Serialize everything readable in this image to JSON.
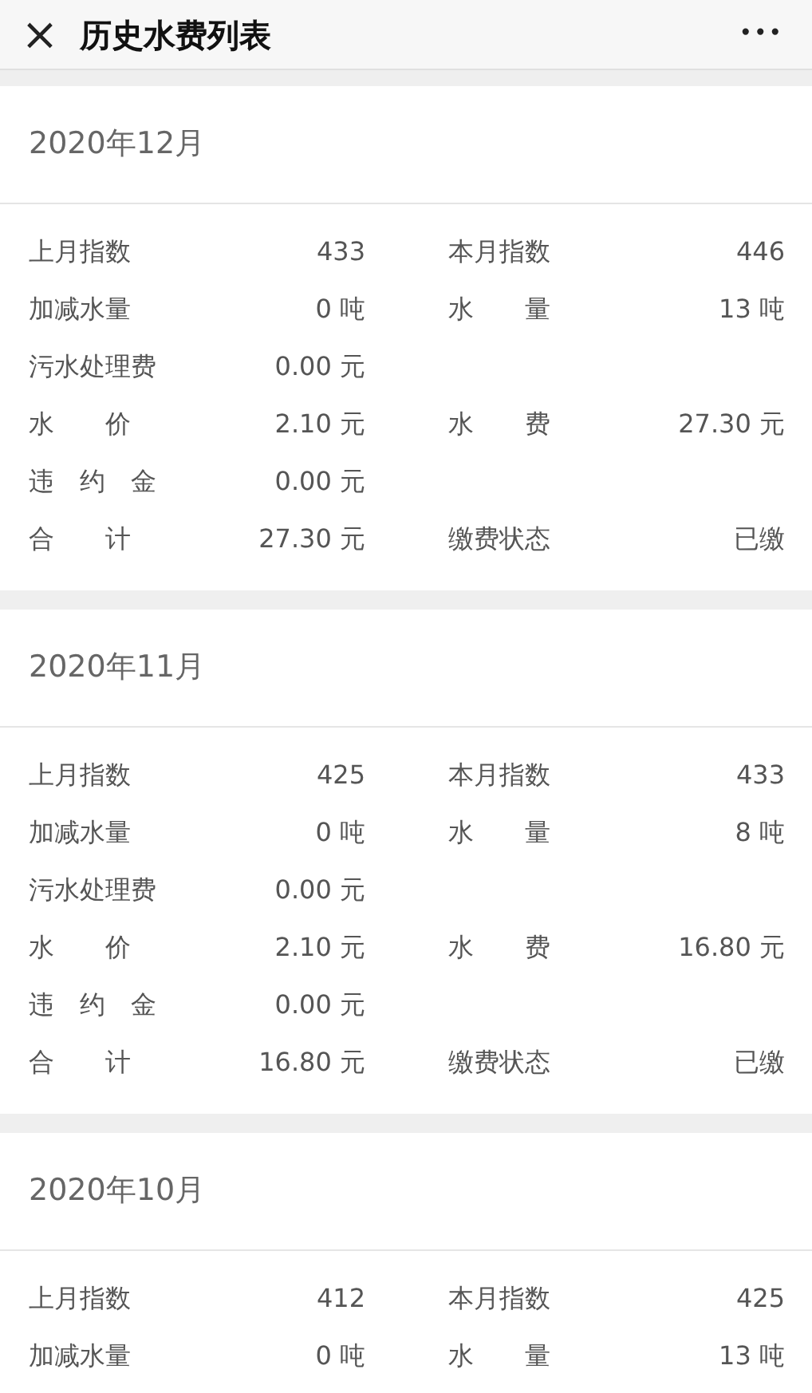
{
  "header": {
    "close": "×",
    "title": "历史水费列表",
    "more": "•••"
  },
  "months": [
    {
      "title": "2020年12月",
      "rows": [
        {
          "left": {
            "label": "上月指数",
            "value": "433"
          },
          "right": {
            "label": "本月指数",
            "value": "446"
          }
        },
        {
          "left": {
            "label": "加减水量",
            "value": "0 吨"
          },
          "right": {
            "label": "水　　量",
            "value": "13 吨"
          }
        },
        {
          "left": {
            "label": "污水处理费",
            "value": "0.00 元"
          }
        },
        {
          "left": {
            "label": "水　　价",
            "value": "2.10 元"
          },
          "right": {
            "label": "水　　费",
            "value": "27.30 元"
          }
        },
        {
          "left": {
            "label": "违　约　金",
            "value": "0.00 元"
          }
        },
        {
          "left": {
            "label": "合　　计",
            "value": "27.30 元"
          },
          "right": {
            "label": "缴费状态",
            "value": "已缴"
          }
        }
      ]
    },
    {
      "title": "2020年11月",
      "rows": [
        {
          "left": {
            "label": "上月指数",
            "value": "425"
          },
          "right": {
            "label": "本月指数",
            "value": "433"
          }
        },
        {
          "left": {
            "label": "加减水量",
            "value": "0 吨"
          },
          "right": {
            "label": "水　　量",
            "value": "8 吨"
          }
        },
        {
          "left": {
            "label": "污水处理费",
            "value": "0.00 元"
          }
        },
        {
          "left": {
            "label": "水　　价",
            "value": "2.10 元"
          },
          "right": {
            "label": "水　　费",
            "value": "16.80 元"
          }
        },
        {
          "left": {
            "label": "违　约　金",
            "value": "0.00 元"
          }
        },
        {
          "left": {
            "label": "合　　计",
            "value": "16.80 元"
          },
          "right": {
            "label": "缴费状态",
            "value": "已缴"
          }
        }
      ]
    },
    {
      "title": "2020年10月",
      "rows": [
        {
          "left": {
            "label": "上月指数",
            "value": "412"
          },
          "right": {
            "label": "本月指数",
            "value": "425"
          }
        },
        {
          "left": {
            "label": "加减水量",
            "value": "0 吨"
          },
          "right": {
            "label": "水　　量",
            "value": "13 吨"
          }
        }
      ]
    }
  ]
}
